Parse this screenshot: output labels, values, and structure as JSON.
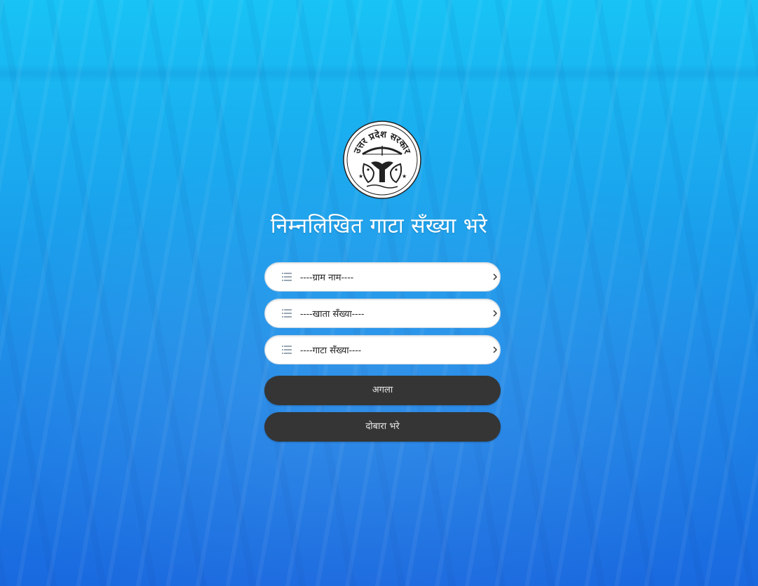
{
  "page": {
    "title": "निम्नलिखित गाटा सँख्या भरे"
  },
  "emblem": {
    "icon": "up-government-emblem-icon",
    "text": "उत्तर प्रदेश सरकार"
  },
  "form": {
    "village_select": {
      "value": "----ग्राम नाम----",
      "icon": "list-icon"
    },
    "khata_select": {
      "value": "----खाता सँख्या----",
      "icon": "list-icon"
    },
    "gata_select": {
      "value": "----गाटा सँख्या----",
      "icon": "list-icon"
    }
  },
  "buttons": {
    "next_label": "अगला",
    "reset_label": "दोबारा भरे"
  },
  "colors": {
    "background_top": "#18c3f5",
    "background_bottom": "#1a69df",
    "button": "#353535",
    "input_background": "#ffffff"
  }
}
